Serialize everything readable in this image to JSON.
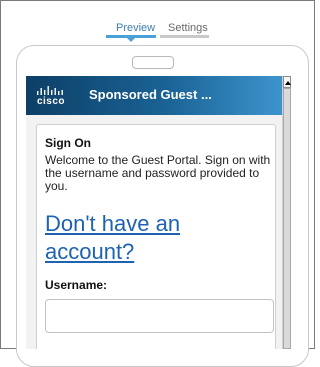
{
  "tabs": [
    {
      "label": "Preview"
    },
    {
      "label": "Settings"
    }
  ],
  "header": {
    "logo_text": "cisco",
    "title": "Sponsored Guest ..."
  },
  "card": {
    "title": "Sign On",
    "welcome": "Welcome to the Guest Portal. Sign on with the username and password provided to you.",
    "account_link": "Don't have an account?",
    "username_label": "Username:",
    "username_value": ""
  },
  "colors": {
    "header_start": "#0d3f66",
    "header_end": "#3d94cc",
    "link": "#1d63b0",
    "active_tab": "#4aa1d8"
  }
}
